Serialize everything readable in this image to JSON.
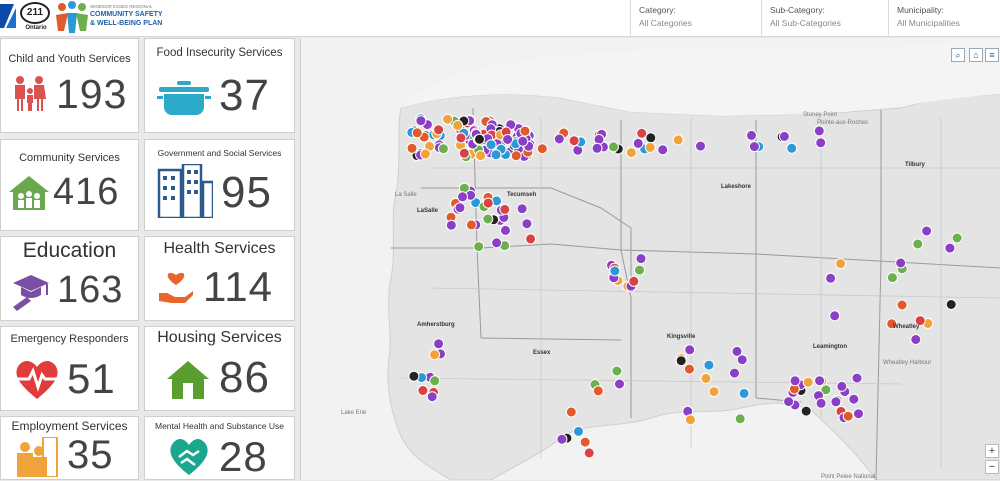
{
  "header": {
    "logo_211": "211",
    "logo_211_sub": "Ontario",
    "plan_top": "WINDSOR ESSEX REGIONAL",
    "plan_line1": "COMMUNITY SAFETY",
    "plan_line2": "& WELL-BEING PLAN"
  },
  "filters": [
    {
      "label": "Category:",
      "value": "All Categories"
    },
    {
      "label": "Sub-Category:",
      "value": "All Sub-Categories"
    },
    {
      "label": "Municipality:",
      "value": "All Municipalities"
    }
  ],
  "cards": {
    "child": {
      "title": "Child and Youth Services",
      "count": "193",
      "icon": "family-icon",
      "color": "#d9534f"
    },
    "food": {
      "title": "Food Insecurity Services",
      "count": "37",
      "icon": "pot-icon",
      "color": "#2aa9c9"
    },
    "community": {
      "title": "Community Services",
      "count": "416",
      "icon": "community-house-icon",
      "color": "#6aa84f"
    },
    "gov": {
      "title": "Government and Social Services",
      "count": "95",
      "icon": "buildings-icon",
      "color": "#2d5a8c"
    },
    "education": {
      "title": "Education",
      "count": "163",
      "icon": "graduation-cap-icon",
      "color": "#7a4fa3"
    },
    "health": {
      "title": "Health Services",
      "count": "114",
      "icon": "hand-heart-icon",
      "color": "#e8662c"
    },
    "emergency": {
      "title": "Emergency Responders",
      "count": "51",
      "icon": "heartbeat-icon",
      "color": "#e23b3b"
    },
    "housing": {
      "title": "Housing Services",
      "count": "86",
      "icon": "house-icon",
      "color": "#5a9e2f"
    },
    "employment": {
      "title": "Employment Services",
      "count": "35",
      "icon": "workers-icon",
      "color": "#f0a33a"
    },
    "mental": {
      "title": "Mental Health and Substance Use",
      "count": "28",
      "icon": "heart-hands-icon",
      "color": "#1aa68f"
    }
  },
  "map": {
    "labels": {
      "tecumseh": "Tecumseh",
      "lakeshore": "Lakeshore",
      "lasalle": "LaSalle",
      "amherstburg": "Amherstburg",
      "essex": "Essex",
      "kingsville": "Kingsville",
      "leamington": "Leamington",
      "wheatley": "Wheatley",
      "harbour": "Wheatley Harbour",
      "tilbury": "Tilbury",
      "stoney": "Stoney Point",
      "pointe": "Pointe-aux-Roches",
      "lasalle2": "La Salle",
      "pointpelee": "Point Pelee National",
      "lakeerie": "Lake Erie"
    },
    "buttons": {
      "search": "⌕",
      "home": "⌂",
      "list": "≡"
    },
    "zoom": {
      "in": "+",
      "out": "−"
    },
    "colors": {
      "water": "#f2f2f2",
      "land": "#e4e4e4",
      "poi": "#8a3fc4"
    }
  }
}
